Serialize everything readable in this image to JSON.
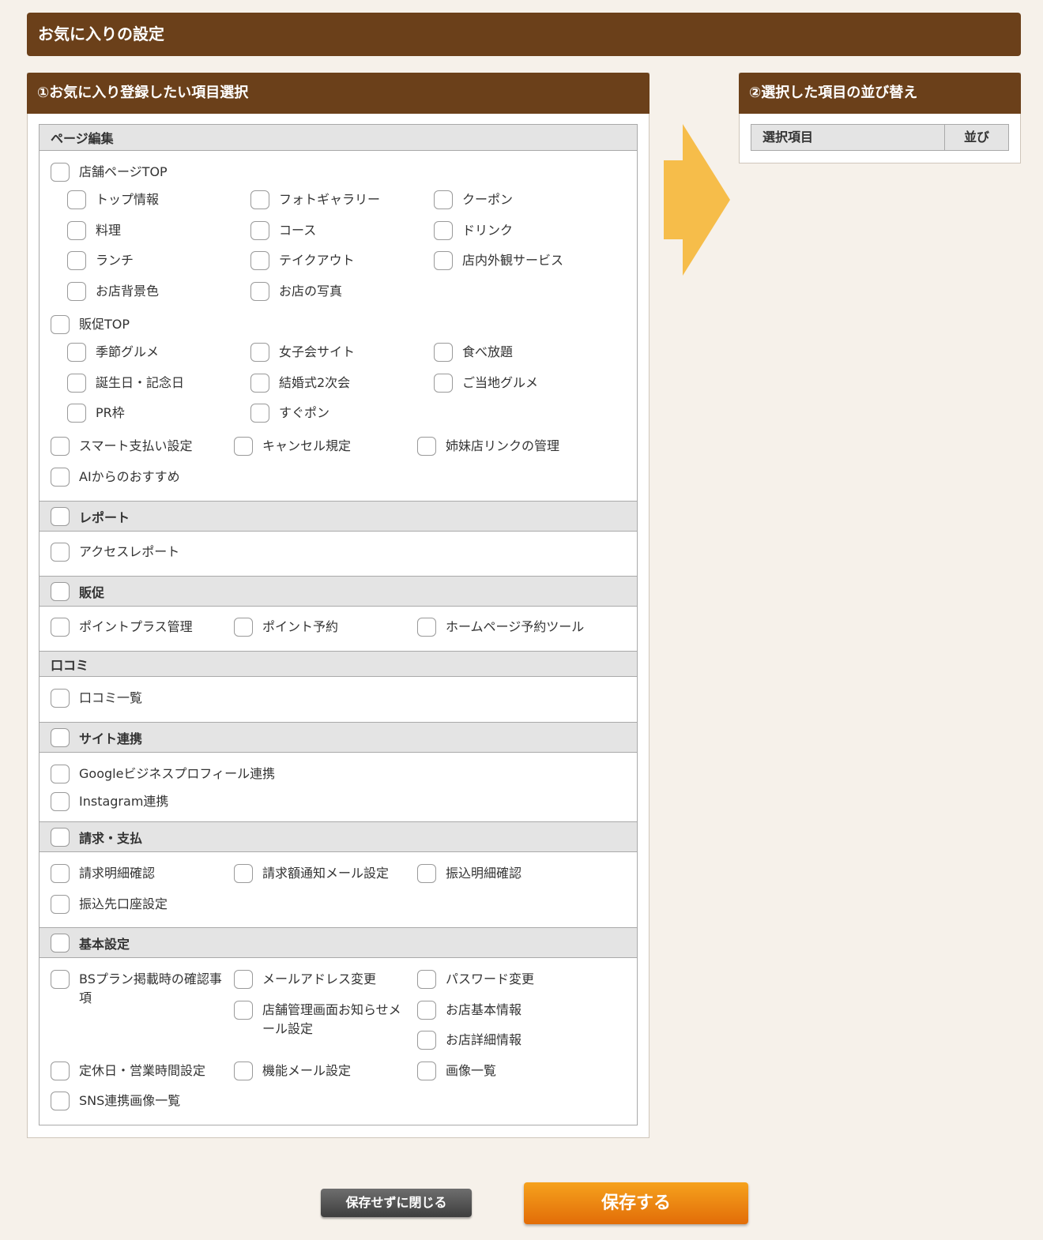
{
  "page": {
    "title": "お気に入りの設定"
  },
  "left_panel": {
    "title": "①お気に入り登録したい項目選択",
    "sections": {
      "page_edit": {
        "title": "ページ編集",
        "store_top": "店舗ページTOP",
        "store_children": [
          "トップ情報",
          "フォトギャラリー",
          "クーポン",
          "料理",
          "コース",
          "ドリンク",
          "ランチ",
          "テイクアウト",
          "店内外観サービス",
          "お店背景色",
          "お店の写真"
        ],
        "promo_top": "販促TOP",
        "promo_children": [
          "季節グルメ",
          "女子会サイト",
          "食べ放題",
          "誕生日・記念日",
          "結婚式2次会",
          "ご当地グルメ",
          "PR枠",
          "すぐポン"
        ],
        "others": [
          "スマート支払い設定",
          "キャンセル規定",
          "姉妹店リンクの管理",
          "AIからのおすすめ"
        ]
      },
      "report": {
        "title": "レポート",
        "items": [
          "アクセスレポート"
        ]
      },
      "promotion": {
        "title": "販促",
        "items": [
          "ポイントプラス管理",
          "ポイント予約",
          "ホームページ予約ツール"
        ]
      },
      "reviews": {
        "title": "口コミ",
        "items": [
          "口コミ一覧"
        ]
      },
      "site_link": {
        "title": "サイト連携",
        "items": [
          "Googleビジネスプロフィール連携",
          "Instagram連携"
        ]
      },
      "billing": {
        "title": "請求・支払",
        "items": [
          "請求明細確認",
          "請求額通知メール設定",
          "振込明細確認",
          "振込先口座設定"
        ]
      },
      "basic": {
        "title": "基本設定",
        "items": [
          "BSプラン掲載時の確認事項",
          "メールアドレス変更",
          "パスワード変更",
          "店舗管理画面お知らせメール設定",
          "お店基本情報",
          "お店詳細情報",
          "定休日・営業時間設定",
          "機能メール設定",
          "画像一覧",
          "SNS連携画像一覧"
        ]
      }
    }
  },
  "right_panel": {
    "title": "②選択した項目の並び替え",
    "columns": [
      "選択項目",
      "並び"
    ]
  },
  "buttons": {
    "close": "保存せずに閉じる",
    "save": "保存する"
  },
  "colors": {
    "header_brown": "#6b401a",
    "arrow": "#f6bd4a",
    "save_orange": "#f08a12"
  }
}
